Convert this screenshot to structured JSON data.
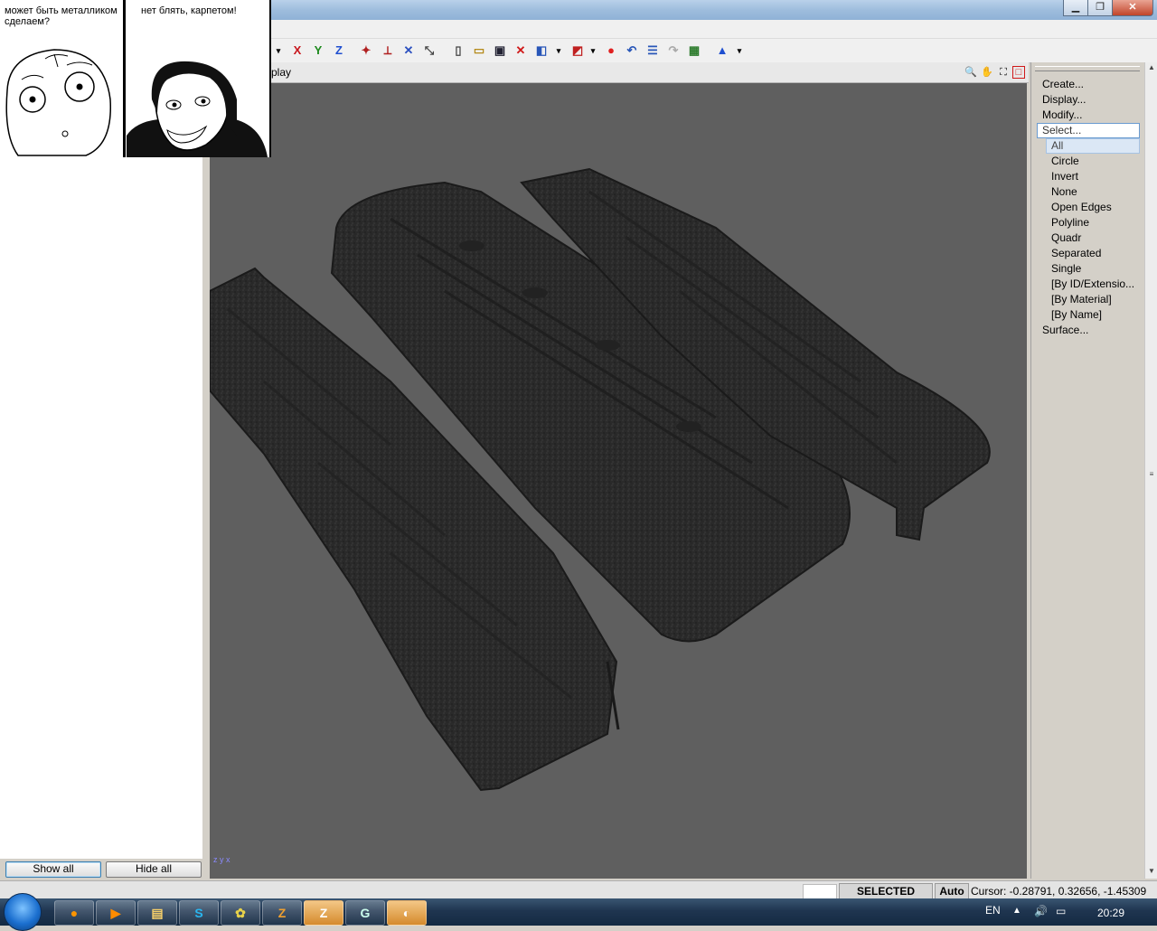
{
  "meme": {
    "left_text": "может быть металликом сделаем?",
    "right_text": "нет блять, карпетом!"
  },
  "window": {
    "minimize_label": "▁",
    "restore_label": "❐",
    "close_label": "✕"
  },
  "toolbar": {
    "axis_x_label": "X",
    "axis_y_label": "Y",
    "axis_z_label": "Z"
  },
  "viewport": {
    "title": "play",
    "axis_indicator": "z y x"
  },
  "right_panel": {
    "menu": {
      "create": "Create...",
      "display": "Display...",
      "modify": "Modify...",
      "select": "Select...",
      "surface": "Surface..."
    },
    "select_submenu": [
      "All",
      "Circle",
      "Invert",
      "None",
      "Open Edges",
      "Polyline",
      "Quadr",
      "Separated",
      "Single",
      "[By ID/Extensio...",
      "[By Material]",
      "[By Name]"
    ]
  },
  "left_panel": {
    "show_all_label": "Show all",
    "hide_all_label": "Hide all"
  },
  "status": {
    "mode": "SELECTED MODE",
    "auto": "Auto",
    "cursor": "Cursor: -0.28791, 0.32656, -1.45309"
  },
  "taskbar": {
    "language": "EN",
    "clock": "20:29"
  },
  "colors": {
    "viewport_bg": "#5f5f5f",
    "mesh_color": "#2b2b2b",
    "taskbar": "#1f3550"
  }
}
